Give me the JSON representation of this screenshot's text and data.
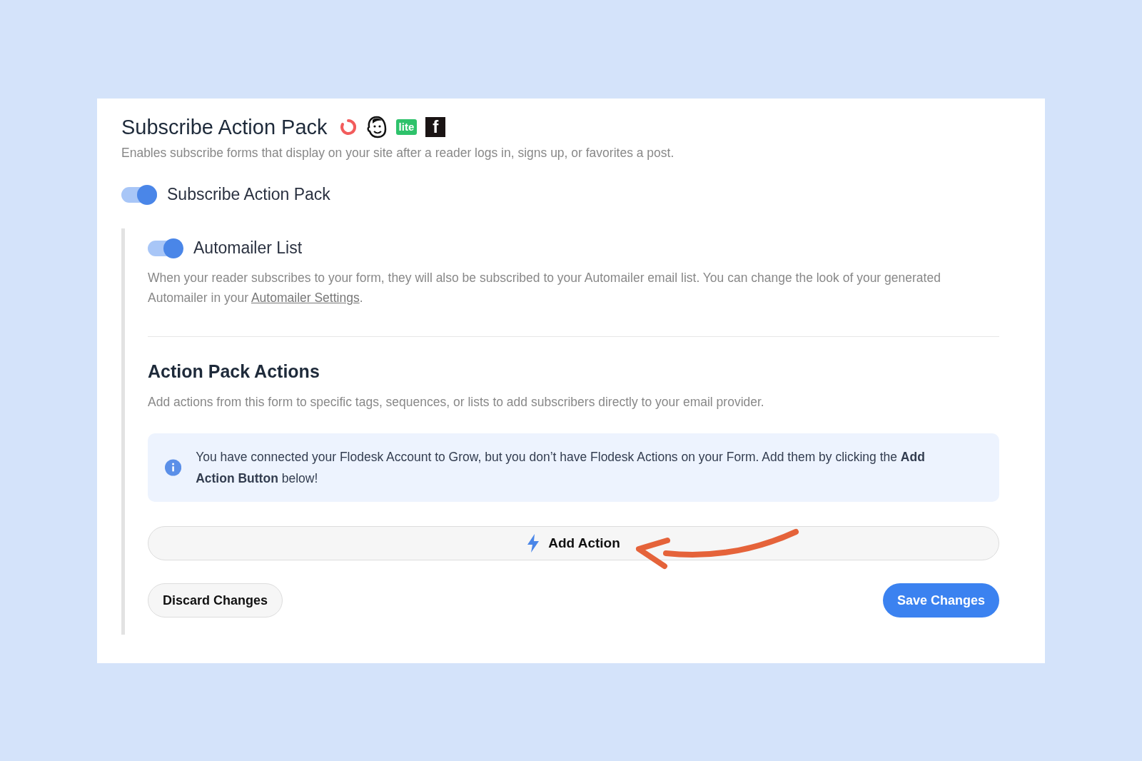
{
  "header": {
    "title": "Subscribe Action Pack",
    "providers": [
      {
        "kind": "ring"
      },
      {
        "kind": "monkey"
      },
      {
        "kind": "lite",
        "label": "lite"
      },
      {
        "kind": "fb",
        "label": "f"
      }
    ],
    "description": "Enables subscribe forms that display on your site after a reader logs in, signs up, or favorites a post."
  },
  "main_toggle": {
    "label": "Subscribe Action Pack",
    "on": true
  },
  "automailer": {
    "label": "Automailer List",
    "on": true,
    "description": "When your reader subscribes to your form, they will also be subscribed to your Automailer email list. You can change the look of your generated Automailer in your ",
    "link": "Automailer Settings",
    "after": "."
  },
  "actions": {
    "title": "Action Pack Actions",
    "description": "Add actions from this form to specific tags, sequences, or lists to add subscribers directly to your email provider.",
    "notice": "You have connected your Flodesk Account to Grow, but you don’t have Flodesk Actions on your Form. Add them by clicking the **Add Action Button** below!",
    "add_button": "Add Action"
  },
  "buttons": {
    "discard": "Discard Changes",
    "save": "Save Changes"
  }
}
